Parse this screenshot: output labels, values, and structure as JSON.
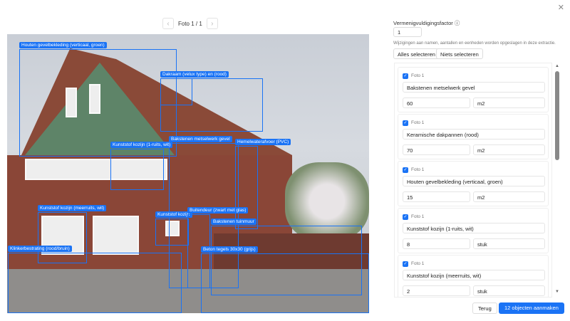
{
  "viewer": {
    "title": "Foto 1 / 1",
    "prev_icon": "chevron-left-icon",
    "next_icon": "chevron-right-icon",
    "close_icon": "close-icon"
  },
  "detections": [
    {
      "label": "Houten gevelbekleding (verticaal, groen)"
    },
    {
      "label": "Dakraam (velux type) en (rood)"
    },
    {
      "label": "Bakstenen metselwerk gevel"
    },
    {
      "label": "Kunststof kozijn (1-ruits, wit)"
    },
    {
      "label": "Hemelwaterafvoer (PVC)"
    },
    {
      "label": "Kunststof kozijn (meerruits, wit)"
    },
    {
      "label": "Kunststof kozijn"
    },
    {
      "label": "Buitendeur (zwart met glas)"
    },
    {
      "label": "Bakstenen tuinmuur"
    },
    {
      "label": "Klinkerbestrating (rood/bruin)"
    },
    {
      "label": "Beton tegels 30x30 (grijs)"
    }
  ],
  "panel": {
    "factor_label": "Vermenigvuldigingsfactor",
    "factor_value": "1",
    "note": "Wijzigingen aan namen, aantallen en eenheden worden opgeslagen in deze extractie.",
    "select_all": "Alles selecteren",
    "select_none": "Niets selecteren",
    "items": [
      {
        "photo": "Foto 1",
        "name": "Bakstenen metselwerk gevel",
        "qty": "60",
        "unit": "m2",
        "checked": true
      },
      {
        "photo": "Foto 1",
        "name": "Keramische dakpannen (rood)",
        "qty": "70",
        "unit": "m2",
        "checked": true
      },
      {
        "photo": "Foto 1",
        "name": "Houten gevelbekleding (verticaal, groen)",
        "qty": "15",
        "unit": "m2",
        "checked": true
      },
      {
        "photo": "Foto 1",
        "name": "Kunststof kozijn (1-ruits, wit)",
        "qty": "8",
        "unit": "stuk",
        "checked": true
      },
      {
        "photo": "Foto 1",
        "name": "Kunststof kozijn (meerruits, wit)",
        "qty": "2",
        "unit": "stuk",
        "checked": true
      }
    ],
    "back": "Terug",
    "create": "12 objecten aanmaken",
    "accent": "#1a73f5"
  }
}
